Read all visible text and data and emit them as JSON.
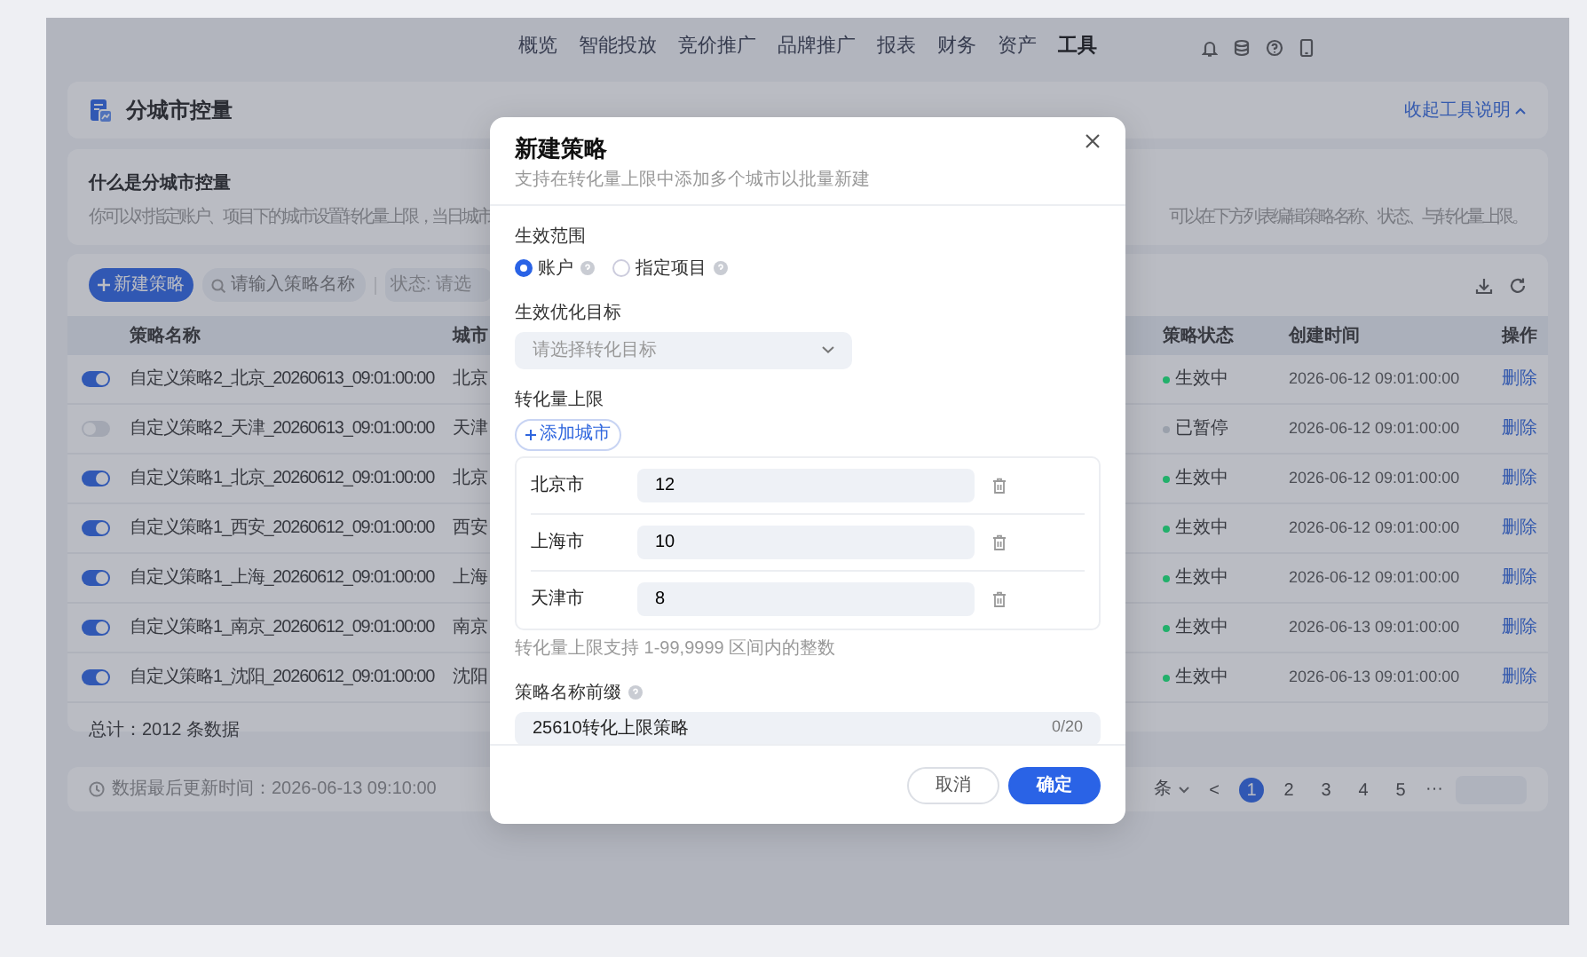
{
  "nav": {
    "items": [
      {
        "label": "概览",
        "selected": false
      },
      {
        "label": "智能投放",
        "selected": false
      },
      {
        "label": "竞价推广",
        "selected": false
      },
      {
        "label": "品牌推广",
        "selected": false
      },
      {
        "label": "报表",
        "selected": false
      },
      {
        "label": "财务",
        "selected": false
      },
      {
        "label": "资产",
        "selected": false
      },
      {
        "label": "工具",
        "selected": true
      }
    ]
  },
  "header": {
    "title": "分城市控量",
    "toggle_link": "收起工具说明"
  },
  "info": {
    "title": "什么是分城市控量",
    "description_left": "你可以对指定账户、项目下的城市设置转化量上限，当日城市",
    "description_right": "可以在下方列表编辑策略名称、状态、与转化量上限。"
  },
  "toolbar": {
    "new_button": "新建策略",
    "search": {
      "placeholder": "请输入策略名称"
    },
    "status_filter": "状态: 请选"
  },
  "table": {
    "columns": [
      "策略名称",
      "城市",
      "策略状态",
      "创建时间",
      "操作"
    ],
    "rows": [
      {
        "on": true,
        "name": "自定义策略2_北京_20260613_09:01:00:00",
        "city": "北京",
        "status": "生效中",
        "color": "#22b06b",
        "created": "2026-06-12 09:01:00:00",
        "action": "删除"
      },
      {
        "on": false,
        "name": "自定义策略2_天津_20260613_09:01:00:00",
        "city": "天津",
        "status": "已暂停",
        "color": "#9aa0ab",
        "created": "2026-06-12 09:01:00:00",
        "action": "删除"
      },
      {
        "on": true,
        "name": "自定义策略1_北京_20260612_09:01:00:00",
        "city": "北京",
        "status": "生效中",
        "color": "#22b06b",
        "created": "2026-06-12 09:01:00:00",
        "action": "删除"
      },
      {
        "on": true,
        "name": "自定义策略1_西安_20260612_09:01:00:00",
        "city": "西安",
        "status": "生效中",
        "color": "#22b06b",
        "created": "2026-06-12 09:01:00:00",
        "action": "删除"
      },
      {
        "on": true,
        "name": "自定义策略1_上海_20260612_09:01:00:00",
        "city": "上海",
        "status": "生效中",
        "color": "#22b06b",
        "created": "2026-06-12 09:01:00:00",
        "action": "删除"
      },
      {
        "on": true,
        "name": "自定义策略1_南京_20260612_09:01:00:00",
        "city": "南京",
        "status": "生效中",
        "color": "#22b06b",
        "created": "2026-06-13 09:01:00:00",
        "action": "删除"
      },
      {
        "on": true,
        "name": "自定义策略1_沈阳_20260612_09:01:00:00",
        "city": "沈阳",
        "status": "生效中",
        "color": "#22b06b",
        "created": "2026-06-13 09:01:00:00",
        "action": "删除"
      }
    ],
    "total": "总计：2012 条数据"
  },
  "footer": {
    "updated": "数据最后更新时间：2026-06-13 09:10:00",
    "page_size": "条",
    "prev": "<",
    "pages": [
      {
        "label": "1",
        "selected": true
      },
      {
        "label": "2",
        "selected": false
      },
      {
        "label": "3",
        "selected": false
      },
      {
        "label": "4",
        "selected": false
      },
      {
        "label": "5",
        "selected": false
      }
    ],
    "ellipsis": "···"
  },
  "modal": {
    "title": "新建策略",
    "subtitle": "支持在转化量上限中添加多个城市以批量新建",
    "scope": {
      "label": "生效范围",
      "options": [
        {
          "label": "账户",
          "selected": true
        },
        {
          "label": "指定项目",
          "selected": false
        }
      ]
    },
    "goal": {
      "label": "生效优化目标",
      "placeholder": "请选择转化目标"
    },
    "limit": {
      "label": "转化量上限",
      "add_button": "添加城市",
      "cities": [
        {
          "name": "北京市",
          "value": "12"
        },
        {
          "name": "上海市",
          "value": "10"
        },
        {
          "name": "天津市",
          "value": "8"
        }
      ],
      "hint": "转化量上限支持 1-99,9999 区间内的整数"
    },
    "prefix": {
      "label": "策略名称前缀",
      "value": "25610转化上限策略",
      "counter": "0/20"
    },
    "buttons": [
      {
        "label": "取消",
        "kind": "secondary"
      },
      {
        "label": "确定",
        "kind": "primary"
      }
    ]
  }
}
